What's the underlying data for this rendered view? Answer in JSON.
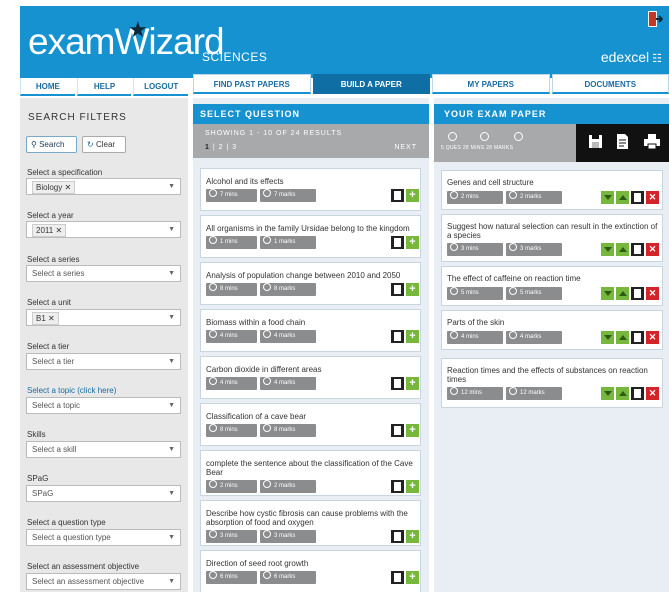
{
  "header": {
    "logo": "examWizard",
    "section": "SCIENCES",
    "brand": "edexcel",
    "brand_mark": "☷"
  },
  "nav_left": [
    "HOME",
    "HELP",
    "LOGOUT"
  ],
  "nav_right": [
    "FIND PAST PAPERS",
    "BUILD A PAPER",
    "MY PAPERS",
    "DOCUMENTS"
  ],
  "sidebar": {
    "title": "SEARCH FILTERS",
    "search_label": "Search",
    "clear_label": "Clear",
    "filters": [
      {
        "label": "Select a specification",
        "value": "Biology",
        "tag": true
      },
      {
        "label": "Select a year",
        "value": "2011",
        "tag": true
      },
      {
        "label": "Select a series",
        "value": "Select a series",
        "tag": false
      },
      {
        "label": "Select a unit",
        "value": "B1",
        "tag": true
      },
      {
        "label": "Select a tier",
        "value": "Select a tier",
        "tag": false
      },
      {
        "label": "Select a topic (click here)",
        "value": "Select a topic",
        "tag": false,
        "link": true
      },
      {
        "label": "Skills",
        "value": "Select a skill",
        "tag": false
      },
      {
        "label": "SPaG",
        "value": "SPaG",
        "tag": false
      },
      {
        "label": "Select a question type",
        "value": "Select a question type",
        "tag": false
      },
      {
        "label": "Select an assessment objective",
        "value": "Select an assessment objective",
        "tag": false
      }
    ]
  },
  "select_question": {
    "title": "SELECT QUESTION",
    "showing": "SHOWING 1 - 10 OF 24 RESULTS",
    "pages": [
      "1",
      "2",
      "3"
    ],
    "next": "NEXT",
    "questions": [
      {
        "title": "Alcohol and its effects",
        "mins": "7 mins",
        "marks": "7 marks"
      },
      {
        "title": "All organisms in the family Ursidae belong to the kingdom",
        "mins": "1 mins",
        "marks": "1 marks"
      },
      {
        "title": "Analysis of population change between 2010 and 2050",
        "mins": "8 mins",
        "marks": "8 marks"
      },
      {
        "title": "Biomass within a food chain",
        "mins": "4 mins",
        "marks": "4 marks"
      },
      {
        "title": "Carbon dioxide in different areas",
        "mins": "4 mins",
        "marks": "4 marks"
      },
      {
        "title": "Classification of a cave bear",
        "mins": "8 mins",
        "marks": "8 marks"
      },
      {
        "title": "complete the sentence about the classification of the Cave Bear",
        "mins": "2 mins",
        "marks": "2 marks"
      },
      {
        "title": "Describe how cystic fibrosis can cause problems with the absorption of food and oxygen",
        "mins": "3 mins",
        "marks": "3 marks"
      },
      {
        "title": "Direction of seed root growth",
        "mins": "6 mins",
        "marks": "6 marks"
      }
    ]
  },
  "exam_paper": {
    "title": "YOUR EXAM PAPER",
    "stats": "5 QUES  28 MINS  28 MARKS",
    "questions": [
      {
        "title": "Genes and cell structure",
        "mins": "2 mins",
        "marks": "2 marks"
      },
      {
        "title": "Suggest how natural selection can result in the extinction of a species",
        "mins": "3 mins",
        "marks": "3 marks"
      },
      {
        "title": "The effect of caffeine on reaction time",
        "mins": "5 mins",
        "marks": "5 marks"
      },
      {
        "title": "Parts of the skin",
        "mins": "4 mins",
        "marks": "4 marks"
      },
      {
        "title": "Reaction times and the effects of substances on reaction times",
        "mins": "12 mins",
        "marks": "12 marks"
      }
    ]
  },
  "colors": {
    "brand_blue": "#1592cf",
    "nav_active": "#0f6ea3",
    "add_green": "#77b83c",
    "delete_red": "#d4242b"
  }
}
